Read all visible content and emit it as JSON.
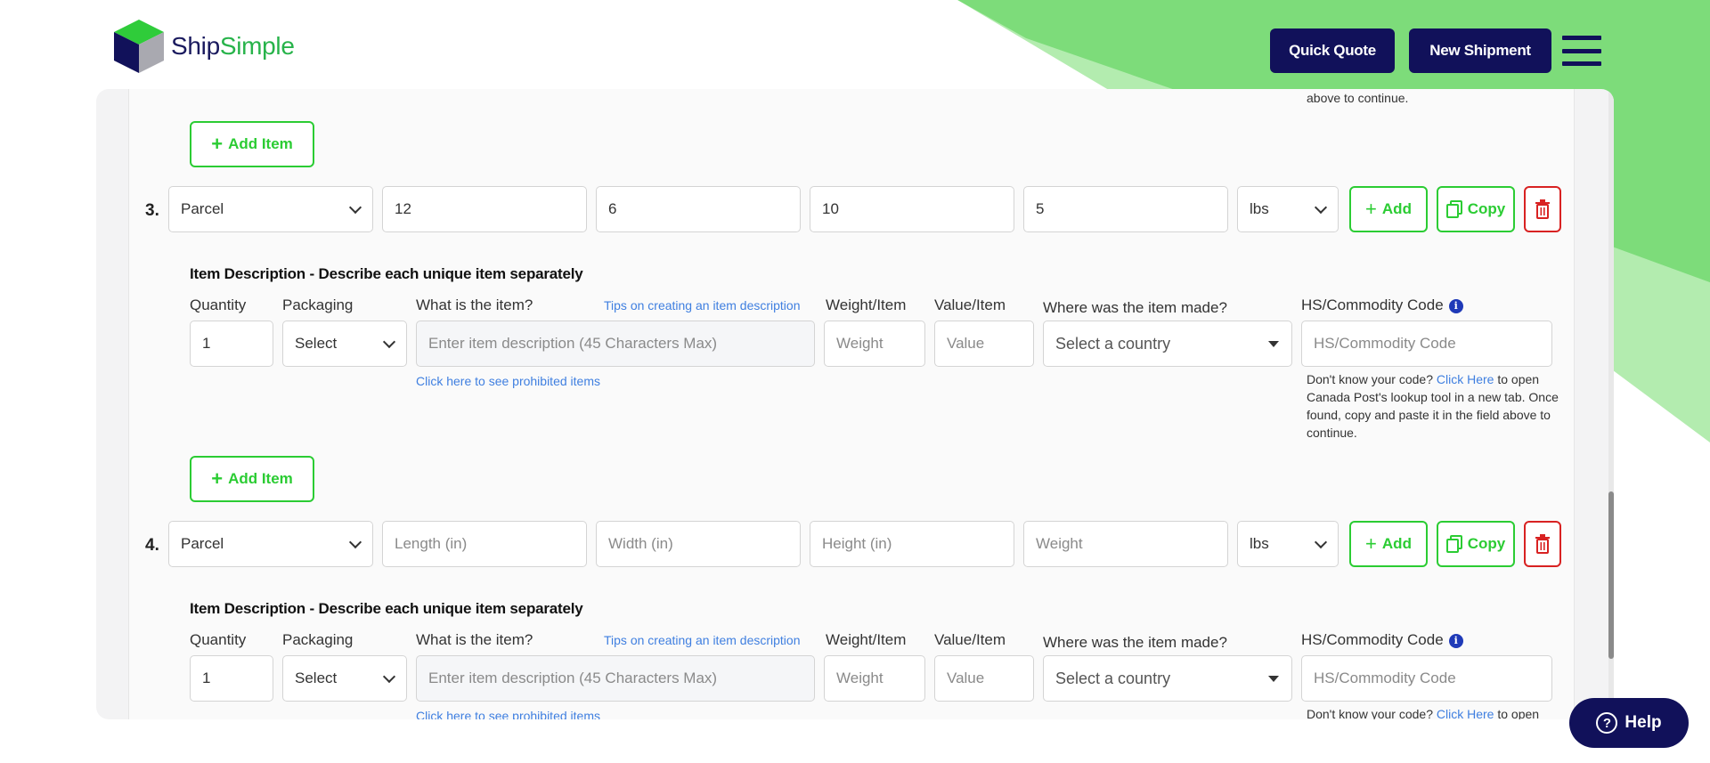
{
  "brand": {
    "part1": "Ship",
    "part2": "Simple"
  },
  "header": {
    "quick_quote": "Quick Quote",
    "new_shipment": "New Shipment"
  },
  "labels": {
    "add_item": "Add Item",
    "add": "Add",
    "copy": "Copy",
    "item_description_title": "Item Description - Describe each unique item separately",
    "quantity": "Quantity",
    "packaging": "Packaging",
    "what_is_item": "What is the item?",
    "tips_link": "Tips on creating an item description",
    "weight_item": "Weight/Item",
    "value_item": "Value/Item",
    "where_made": "Where was the item made?",
    "hs_code": "HS/Commodity Code",
    "prohibited_link": "Click here to see prohibited items",
    "hs_note_1": "Don't know your code?",
    "hs_note_link": "Click Here",
    "hs_note_2": "to open Canada Post's lookup tool in a new tab. Once found, copy and paste it in the field above to continue.",
    "top_note_tail": "above to continue."
  },
  "placeholders": {
    "length": "Length (in)",
    "width": "Width (in)",
    "height": "Height (in)",
    "weight": "Weight",
    "description": "Enter item description (45 Characters Max)",
    "value": "Value",
    "country": "Select a country",
    "hs": "HS/Commodity Code"
  },
  "packages": [
    {
      "number": "3.",
      "type": "Parcel",
      "length": "12",
      "width": "6",
      "height": "10",
      "weight": "5",
      "unit": "lbs",
      "item": {
        "quantity": "1",
        "packaging": "Select"
      }
    },
    {
      "number": "4.",
      "type": "Parcel",
      "length": "",
      "width": "",
      "height": "",
      "weight": "",
      "unit": "lbs",
      "item": {
        "quantity": "1",
        "packaging": "Select"
      }
    }
  ],
  "help": {
    "label": "Help"
  },
  "colors": {
    "navy": "#11115a",
    "green": "#2bcc33",
    "red": "#d82222",
    "link": "#3f7fe0"
  }
}
